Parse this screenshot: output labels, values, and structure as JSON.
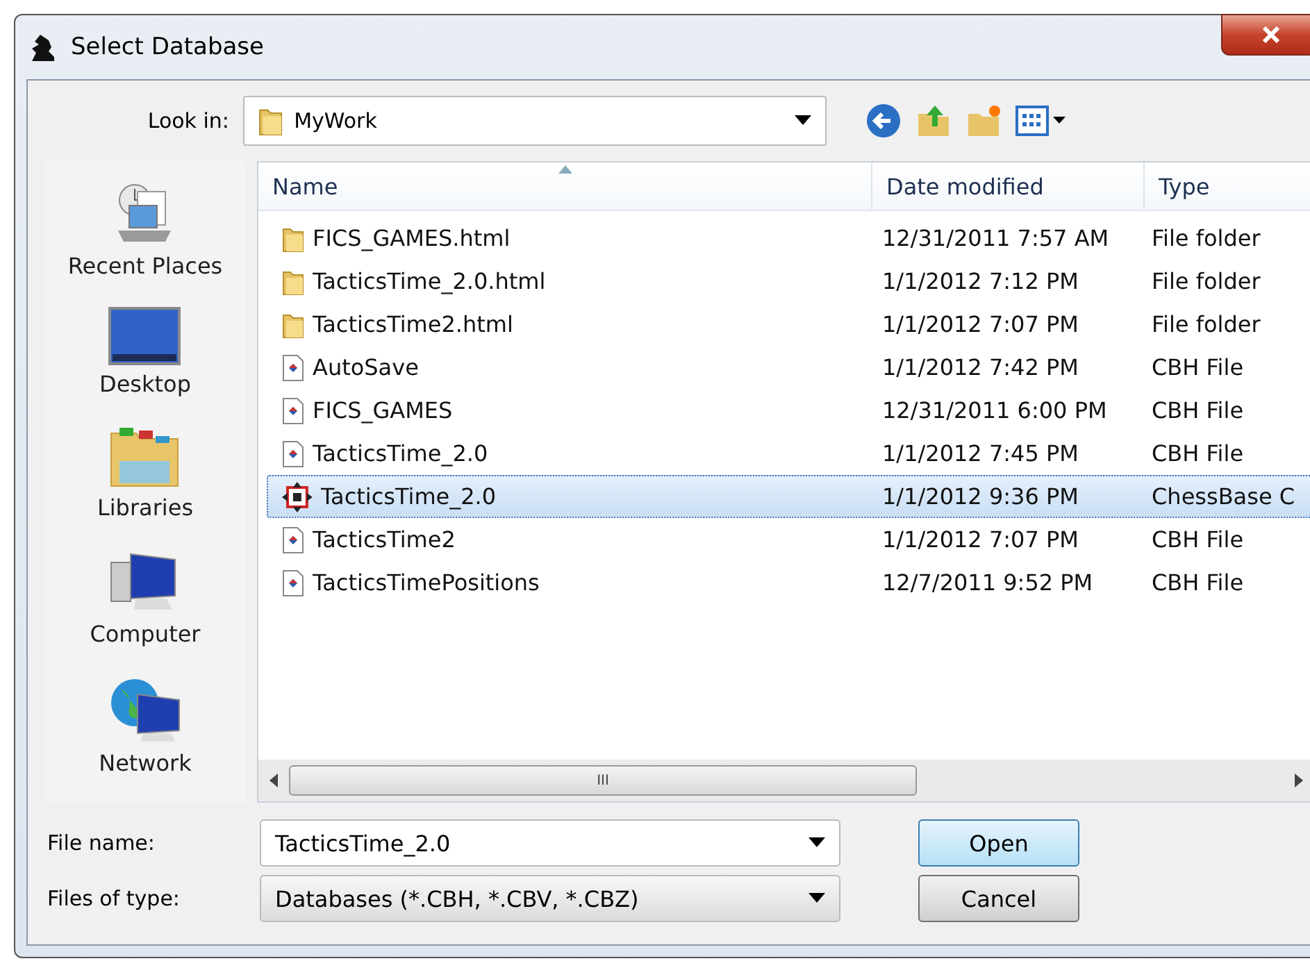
{
  "window": {
    "title": "Select Database"
  },
  "look_in": {
    "label": "Look in:",
    "value": "MyWork"
  },
  "places": [
    {
      "label": "Recent Places",
      "kind": "recent"
    },
    {
      "label": "Desktop",
      "kind": "desktop"
    },
    {
      "label": "Libraries",
      "kind": "libraries"
    },
    {
      "label": "Computer",
      "kind": "computer"
    },
    {
      "label": "Network",
      "kind": "network"
    }
  ],
  "table": {
    "columns": [
      "Name",
      "Date modified",
      "Type"
    ],
    "rows": [
      {
        "name": "FICS_GAMES.html",
        "date": "12/31/2011 7:57 AM",
        "type": "File folder",
        "kind": "folder",
        "selected": false
      },
      {
        "name": "TacticsTime_2.0.html",
        "date": "1/1/2012 7:12 PM",
        "type": "File folder",
        "kind": "folder",
        "selected": false
      },
      {
        "name": "TacticsTime2.html",
        "date": "1/1/2012 7:07 PM",
        "type": "File folder",
        "kind": "folder",
        "selected": false
      },
      {
        "name": "AutoSave",
        "date": "1/1/2012 7:42 PM",
        "type": "CBH File",
        "kind": "cbh",
        "selected": false
      },
      {
        "name": "FICS_GAMES",
        "date": "12/31/2011 6:00 PM",
        "type": "CBH File",
        "kind": "cbh",
        "selected": false
      },
      {
        "name": "TacticsTime_2.0",
        "date": "1/1/2012 7:45 PM",
        "type": "CBH File",
        "kind": "cbh",
        "selected": false
      },
      {
        "name": "TacticsTime_2.0",
        "date": "1/1/2012 9:36 PM",
        "type": "ChessBase C",
        "kind": "chessbase",
        "selected": true
      },
      {
        "name": "TacticsTime2",
        "date": "1/1/2012 7:07 PM",
        "type": "CBH File",
        "kind": "cbh",
        "selected": false
      },
      {
        "name": "TacticsTimePositions",
        "date": "12/7/2011 9:52 PM",
        "type": "CBH File",
        "kind": "cbh",
        "selected": false
      }
    ]
  },
  "file_name": {
    "label": "File name:",
    "value": "TacticsTime_2.0"
  },
  "file_type": {
    "label": "Files of type:",
    "value": "Databases (*.CBH, *.CBV, *.CBZ)"
  },
  "buttons": [
    "Open",
    "Cancel"
  ],
  "scrollbar": {
    "grip": "III"
  }
}
